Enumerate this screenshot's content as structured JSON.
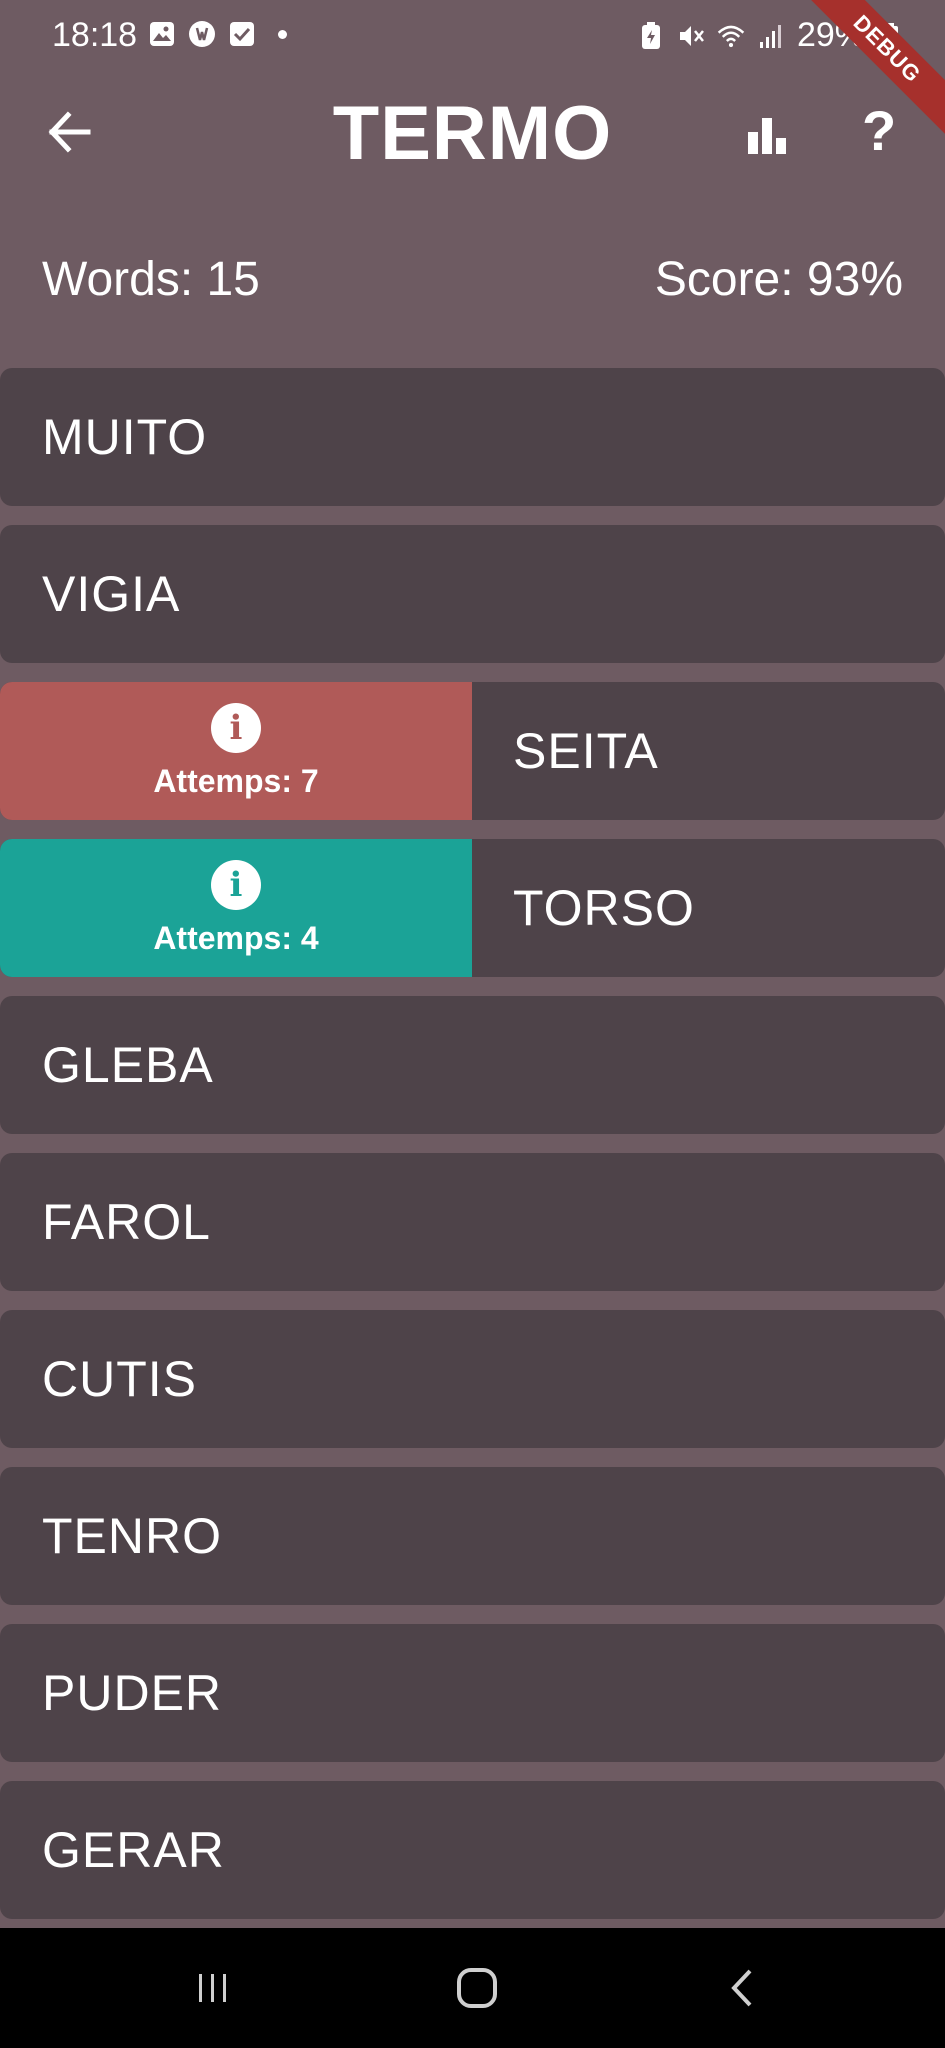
{
  "status": {
    "time": "18:18",
    "battery": "29%",
    "left_icons": [
      "image-icon",
      "app-icon",
      "check-icon",
      "notification-dot"
    ],
    "right_icons": [
      "battery-saver-icon",
      "mute-icon",
      "wifi-icon",
      "signal-icon",
      "battery-icon"
    ]
  },
  "debug_label": "DEBUG",
  "app_bar": {
    "title": "TERMO",
    "back_icon": "arrow-back-icon",
    "stats_icon": "bar-chart-icon",
    "help_label": "?"
  },
  "summary": {
    "words": "Words: 15",
    "score": "Score: 93%"
  },
  "words": [
    {
      "word": "MUITO"
    },
    {
      "word": "VIGIA"
    },
    {
      "word": "SEITA",
      "attempts": "Attemps: 7",
      "status": "failed",
      "color": "#b05a58"
    },
    {
      "word": "TORSO",
      "attempts": "Attemps: 4",
      "status": "solved",
      "color": "#1ba397"
    },
    {
      "word": "GLEBA"
    },
    {
      "word": "FAROL"
    },
    {
      "word": "CUTIS"
    },
    {
      "word": "TENRO"
    },
    {
      "word": "PUDER"
    },
    {
      "word": "GERAR"
    }
  ],
  "nav": {
    "recent_icon": "recent-apps-icon",
    "home_icon": "home-icon",
    "back_icon": "back-icon"
  },
  "colors": {
    "background": "#6e5b62",
    "row": "#4e4349",
    "failed": "#b05a58",
    "solved": "#1ba397"
  }
}
